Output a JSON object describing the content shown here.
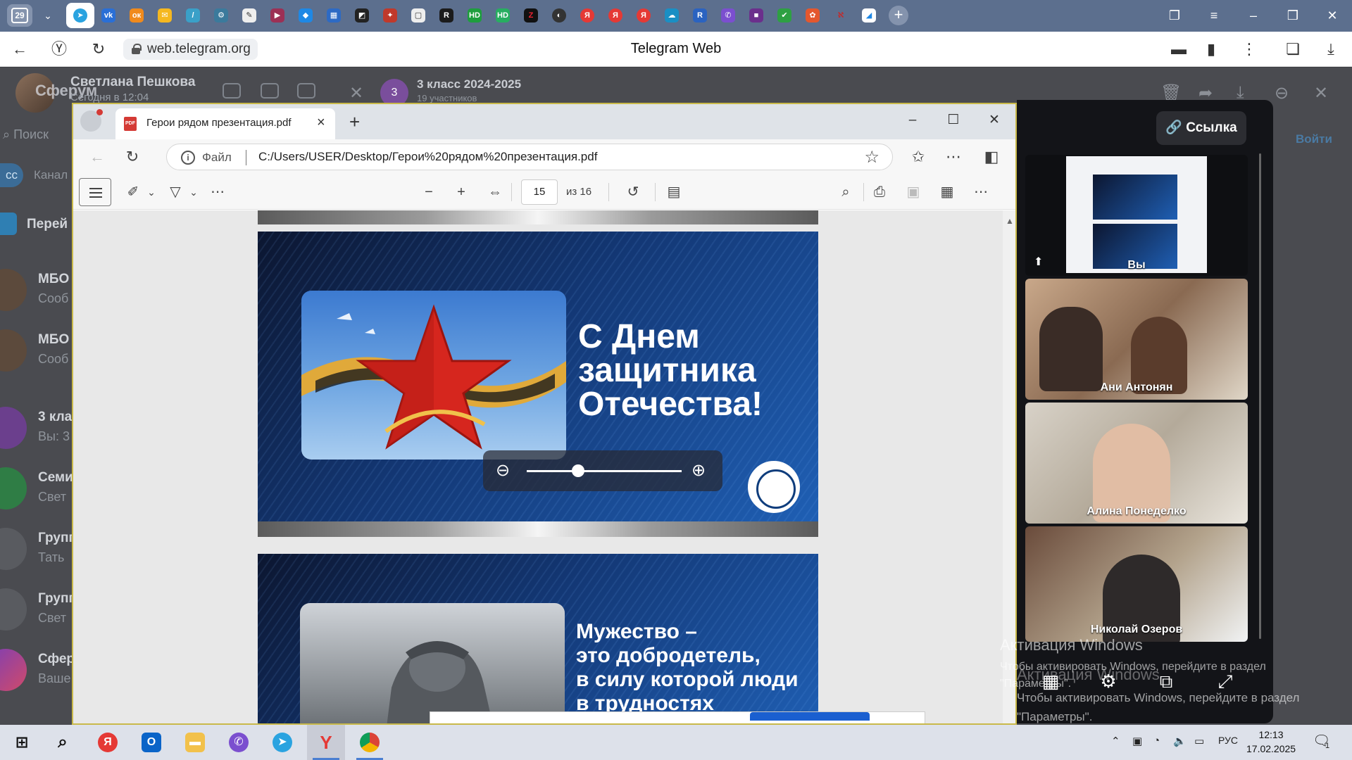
{
  "browser": {
    "tab_count": "29",
    "url": "web.telegram.org",
    "page_title": "Telegram Web"
  },
  "telegram": {
    "brand": "Сферум",
    "user_name": "Светлана Пешкова",
    "user_status": "Сегодня в 12:04",
    "chat_title": "3 класс 2024-2025",
    "chat_subtitle": "19 участников",
    "chat_avatar": "3",
    "search_placeholder": "Поиск",
    "filters": [
      "сс",
      "Канал"
    ],
    "forward_label": "Перей",
    "login_button": "Войти",
    "chats": [
      {
        "title": "МБО",
        "snippet": "Сооб"
      },
      {
        "title": "МБО",
        "snippet": "Сооб"
      },
      {
        "title": "3 кла",
        "snippet": "Вы: 3"
      },
      {
        "title": "Семи",
        "snippet": "Свет"
      },
      {
        "title": "Групп",
        "snippet": "Тать"
      },
      {
        "title": "Групп",
        "snippet": "Свет"
      },
      {
        "title": "Сфер",
        "snippet": "Ваше"
      }
    ]
  },
  "edge": {
    "tab_title": "Герои рядом презентация.pdf",
    "pdf_badge": "PDF",
    "file_label": "Файл",
    "path": "C:/Users/USER/Desktop/Герои%20рядом%20презентация.pdf",
    "page_number": "15",
    "page_total": "из 16",
    "slide1_lines": [
      "С Днем",
      "защитника",
      "Отечества!"
    ],
    "slide2_lines": [
      "Мужество –",
      "это добродетель,",
      "в силу которой люди",
      "в трудностях"
    ],
    "zoom_level": 0.33
  },
  "call": {
    "link_button": "Ссылка",
    "self_label": "Вы",
    "participants": [
      "Ани Антонян",
      "Алина Понеделко",
      "Николай Озеров"
    ]
  },
  "watermark": {
    "title": "Активация Windows",
    "text": "Чтобы активировать Windows, перейдите в раздел \"Параметры\"."
  },
  "taskbar": {
    "lang": "РУС",
    "time": "12:13",
    "date": "17.02.2025",
    "notifications": "1"
  }
}
